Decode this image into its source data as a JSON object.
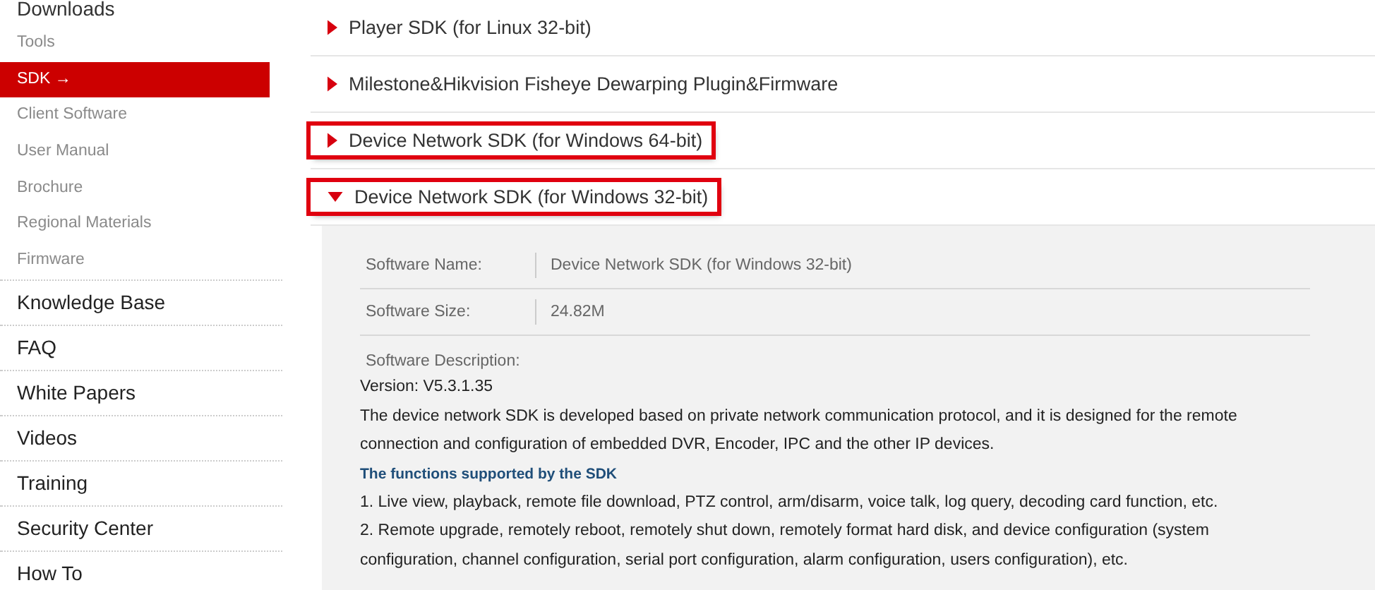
{
  "sidebar": {
    "sub_items": [
      {
        "label": "Downloads",
        "selected": false,
        "kind": "heading"
      },
      {
        "label": "Tools",
        "selected": false,
        "kind": "sub"
      },
      {
        "label": "SDK →",
        "selected": true,
        "kind": "sub"
      },
      {
        "label": "Client Software",
        "selected": false,
        "kind": "sub"
      },
      {
        "label": "User Manual",
        "selected": false,
        "kind": "sub"
      },
      {
        "label": "Brochure",
        "selected": false,
        "kind": "sub"
      },
      {
        "label": "Regional Materials",
        "selected": false,
        "kind": "sub"
      },
      {
        "label": "Firmware",
        "selected": false,
        "kind": "sub"
      }
    ],
    "items": [
      "Knowledge Base",
      "FAQ",
      "White Papers",
      "Videos",
      "Training",
      "Security Center",
      "How To"
    ]
  },
  "downloads": [
    {
      "title": "Player SDK (for Linux 32-bit)",
      "expanded": false,
      "highlighted": false
    },
    {
      "title": "Milestone&Hikvision Fisheye Dewarping Plugin&Firmware",
      "expanded": false,
      "highlighted": false
    },
    {
      "title": "Device Network SDK (for Windows 64-bit)",
      "expanded": false,
      "highlighted": true
    },
    {
      "title": "Device Network SDK (for Windows 32-bit)",
      "expanded": true,
      "highlighted": true
    }
  ],
  "details": {
    "fields": [
      {
        "label": "Software Name:",
        "value": "Device Network SDK (for Windows 32-bit)"
      },
      {
        "label": "Software Size:",
        "value": "24.82M"
      }
    ],
    "description_label": "Software Description:",
    "version": "Version: V5.3.1.35",
    "paragraph": "The device network SDK is developed based on private network communication protocol, and it is designed for the remote connection and configuration of embedded DVR, Encoder, IPC and the other IP devices.",
    "functions_heading": "The functions supported by the SDK",
    "functions": [
      "1. Live view, playback, remote file download, PTZ control, arm/disarm, voice talk, log query, decoding card function, etc.",
      "2. Remote upgrade, remotely reboot, remotely shut down, remotely format hard disk, and device configuration (system configuration, channel configuration, serial port configuration, alarm configuration, users configuration), etc."
    ]
  }
}
